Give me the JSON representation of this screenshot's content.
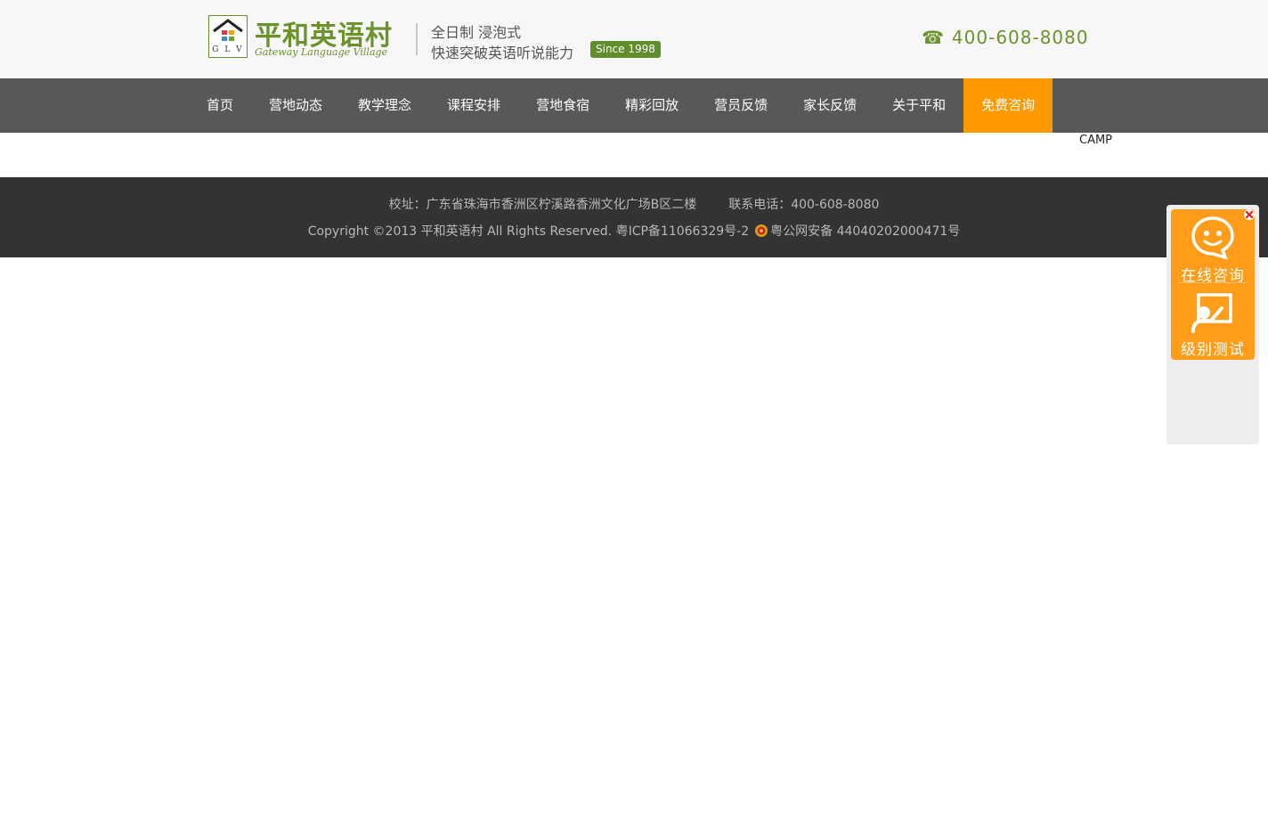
{
  "header": {
    "logo_mark_text": "G L V",
    "logo_title": "平和英语村",
    "logo_subtitle": "Gateway Language Village",
    "tagline_1": "全日制  浸泡式",
    "tagline_2": "快速突破英语听说能力",
    "since_badge": "Since 1998",
    "phone": "400-608-8080",
    "phone_icon": "phone-icon"
  },
  "nav": {
    "items": [
      {
        "label": "首页"
      },
      {
        "label": "营地动态"
      },
      {
        "label": "教学理念"
      },
      {
        "label": "课程安排"
      },
      {
        "label": "营地食宿"
      },
      {
        "label": "精彩回放"
      },
      {
        "label": "营员反馈"
      },
      {
        "label": "家长反馈"
      },
      {
        "label": "关于平和"
      },
      {
        "label": "免费咨询",
        "active": true
      }
    ],
    "active_color": "#ff9900"
  },
  "camp_label": "CAMP",
  "footer": {
    "address": "校址：广东省珠海市香洲区柠溪路香洲文化广场B区二楼",
    "contact_phone": "联系电话：400-608-8080",
    "copyright": "Copyright ©2013 平和英语村 All Rights Reserved. 粤ICP备11066329号-2",
    "police_record": "粤公网安备 44040202000471号"
  },
  "side_panel": {
    "online_consult": "在线咨询",
    "level_test": "级别测试",
    "accent_color": "#ff9c1a"
  }
}
